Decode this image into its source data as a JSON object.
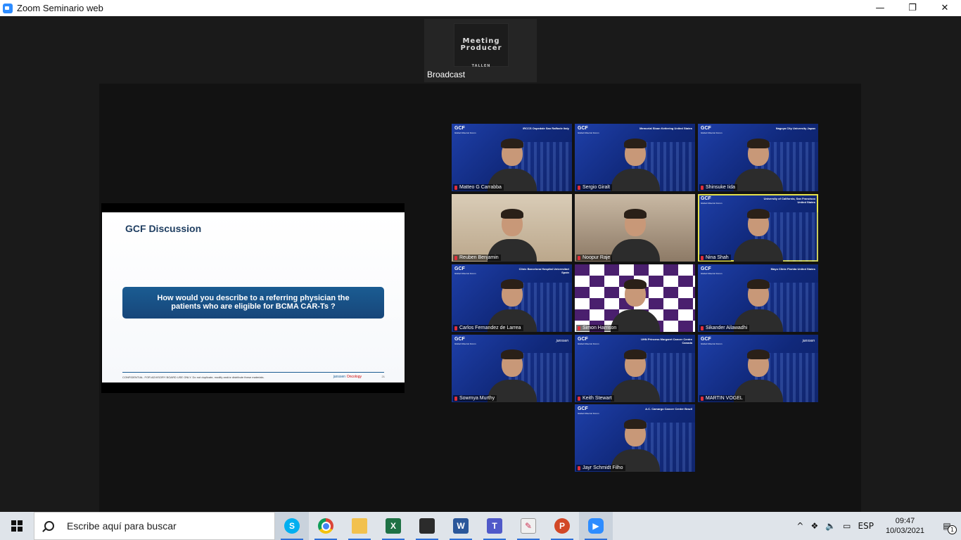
{
  "window": {
    "title": "Zoom Seminario web",
    "minimize": "—",
    "restore": "❐",
    "close": "✕"
  },
  "broadcast": {
    "logo_line1": "Meeting",
    "logo_line2": "Producer",
    "logo_sub": "TALLEN",
    "label": "Broadcast"
  },
  "slide": {
    "title": "GCF Discussion",
    "question_line1": "How would you describe to a referring physician the",
    "question_line2": "patients who are eligible for BCMA CAR-Ts ?",
    "footer_text": "CONFIDENTIAL. FOR ADVISORY BOARD USE ONLY. Do not duplicate, modify and/or distribute these materials.",
    "brand1": "janssen",
    "brand2": "Oncology",
    "page": "21"
  },
  "gallery": {
    "participants": [
      {
        "name": "Matteo G Carrabba",
        "institution": "IRCCS Ospedale San Raffaele Italy",
        "logo": "GCF",
        "logo_sub": "Global Cilta-Cel Forum",
        "speaking": false
      },
      {
        "name": "Sergio Giralt",
        "institution": "Memorial Sloan Kettering United States",
        "logo": "GCF",
        "logo_sub": "Global Cilta-Cel Forum",
        "speaking": false
      },
      {
        "name": "Shinsuke Iida",
        "institution": "Nagoya City University Japan",
        "logo": "GCF",
        "logo_sub": "Global Cilta-Cel Forum",
        "speaking": false
      },
      {
        "name": "Reuben Benjamin",
        "institution": "",
        "logo": "",
        "logo_sub": "",
        "speaking": false
      },
      {
        "name": "Noopur Raje",
        "institution": "",
        "logo": "",
        "logo_sub": "",
        "speaking": false
      },
      {
        "name": "Nina Shah",
        "institution": "University of California, San Francisco United States",
        "logo": "GCF",
        "logo_sub": "Global Cilta-Cel Forum",
        "speaking": true
      },
      {
        "name": "Carlos Fernandez de Larrea",
        "institution": "Clinic Barcelona Hospital Universitari Spain",
        "logo": "GCF",
        "logo_sub": "Global Cilta-Cel Forum",
        "speaking": false
      },
      {
        "name": "Simon Harrison",
        "institution": "",
        "logo": "",
        "logo_sub": "",
        "speaking": false
      },
      {
        "name": "Sikander Ailawadhi",
        "institution": "Mayo Clinic Florida United States",
        "logo": "GCF",
        "logo_sub": "Global Cilta-Cel Forum",
        "speaking": false
      },
      {
        "name": "Sowmya Murthy",
        "institution": "janssen",
        "logo": "GCF",
        "logo_sub": "Global Cilta-Cel Forum",
        "speaking": false
      },
      {
        "name": "Keith Stewart",
        "institution": "UHN Princess Margaret Cancer Centre Canada",
        "logo": "GCF",
        "logo_sub": "Global Cilta-Cel Forum",
        "speaking": false
      },
      {
        "name": "MARTIN VOGEL",
        "institution": "janssen",
        "logo": "GCF",
        "logo_sub": "Global Cilta-Cel Forum",
        "speaking": false
      },
      {
        "name": "Jayr Schmidt Filho",
        "institution": "A.C. Camargo Cancer Center Brazil",
        "logo": "GCF",
        "logo_sub": "Global Cilta-Cel Forum",
        "speaking": false
      }
    ]
  },
  "taskbar": {
    "search_placeholder": "Escribe aquí para buscar",
    "apps": [
      {
        "icon": "skype-icon",
        "glyph": "S"
      },
      {
        "icon": "chrome-icon",
        "glyph": ""
      },
      {
        "icon": "file-explorer-icon",
        "glyph": ""
      },
      {
        "icon": "excel-icon",
        "glyph": "X"
      },
      {
        "icon": "sticky-notes-icon",
        "glyph": ""
      },
      {
        "icon": "word-icon",
        "glyph": "W"
      },
      {
        "icon": "teams-icon",
        "glyph": "T"
      },
      {
        "icon": "paint-icon",
        "glyph": "✎"
      },
      {
        "icon": "powerpoint-icon",
        "glyph": "P"
      },
      {
        "icon": "zoom-icon",
        "glyph": "▶"
      }
    ],
    "tray": {
      "chevron": "^",
      "dropbox": "❖",
      "volume": "🔈",
      "battery": "▭",
      "language": "ESP",
      "time": "09:47",
      "date": "10/03/2021",
      "notifications": "1"
    }
  }
}
